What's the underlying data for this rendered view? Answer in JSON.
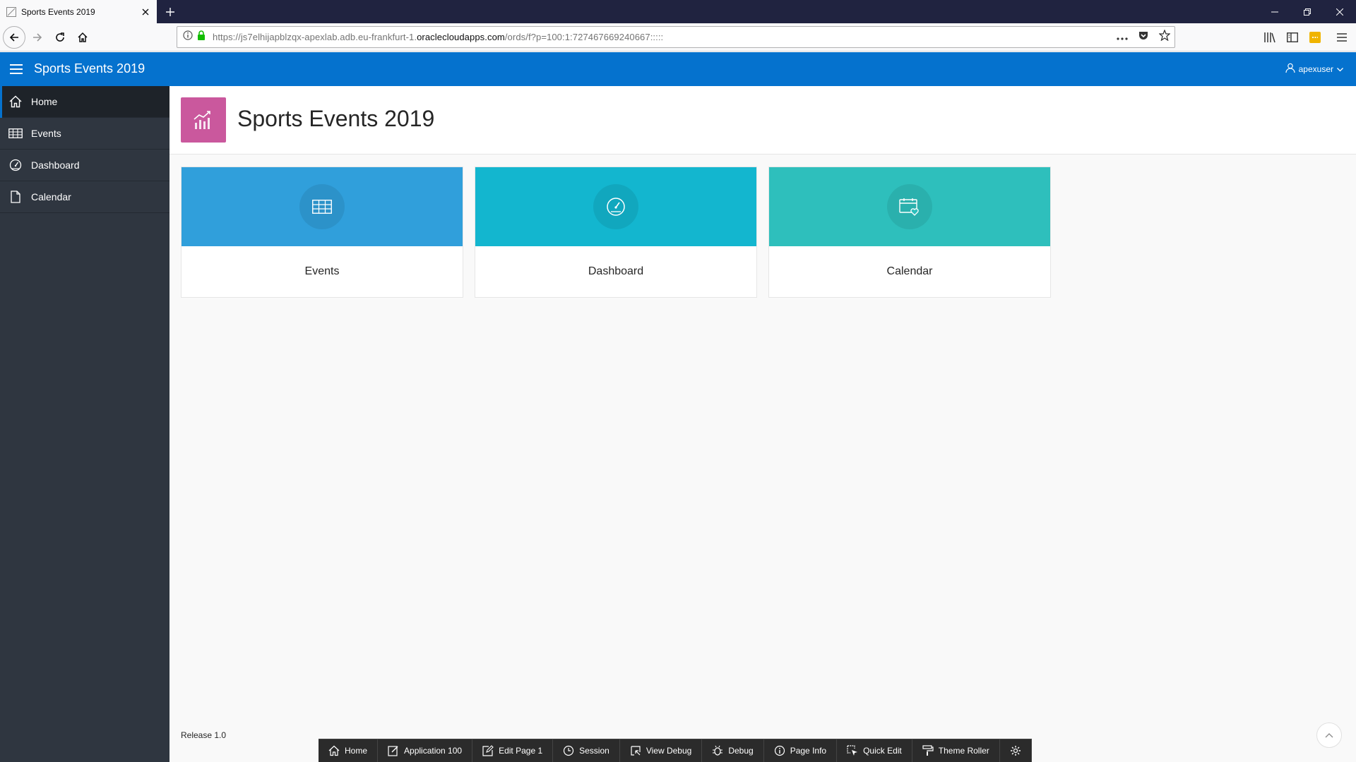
{
  "browser": {
    "tab_title": "Sports Events 2019",
    "url_prefix": "https://js7elhijapblzqx-apexlab.adb.eu-frankfurt-1.",
    "url_domain": "oraclecloudapps.com",
    "url_suffix": "/ords/f?p=100:1:727467669240667:::::",
    "url_actions": [
      "more-icon",
      "pocket-icon",
      "bookmark-star-icon"
    ],
    "toolbar_icons": [
      "library-icon",
      "sidebar-icon",
      "extension-icon",
      "menu-icon"
    ]
  },
  "header": {
    "app_title": "Sports Events 2019",
    "user": "apexuser",
    "color": "#0572ce"
  },
  "sidenav": {
    "items": [
      {
        "label": "Home",
        "icon": "home-icon",
        "active": true
      },
      {
        "label": "Events",
        "icon": "table-icon",
        "active": false
      },
      {
        "label": "Dashboard",
        "icon": "dashboard-icon",
        "active": false
      },
      {
        "label": "Calendar",
        "icon": "file-icon",
        "active": false
      }
    ]
  },
  "hero": {
    "title": "Sports Events 2019",
    "icon": "chart-line-icon",
    "icon_color": "#ca589d"
  },
  "cards": [
    {
      "label": "Events",
      "icon": "table-icon",
      "color": "#309fdb"
    },
    {
      "label": "Dashboard",
      "icon": "dashboard-icon",
      "color": "#13b6cf"
    },
    {
      "label": "Calendar",
      "icon": "calendar-heart-icon",
      "color": "#2ebfbc"
    }
  ],
  "footer": {
    "release": "Release 1.0"
  },
  "devbar": {
    "items": [
      {
        "label": "Home",
        "icon": "home-icon"
      },
      {
        "label": "Application 100",
        "icon": "edit-app-icon"
      },
      {
        "label": "Edit Page 1",
        "icon": "edit-page-icon"
      },
      {
        "label": "Session",
        "icon": "clock-icon"
      },
      {
        "label": "View Debug",
        "icon": "view-debug-icon"
      },
      {
        "label": "Debug",
        "icon": "bug-icon"
      },
      {
        "label": "Page Info",
        "icon": "info-icon"
      },
      {
        "label": "Quick Edit",
        "icon": "quick-edit-icon"
      },
      {
        "label": "Theme Roller",
        "icon": "paint-roller-icon"
      },
      {
        "label": "",
        "icon": "gear-icon"
      }
    ]
  }
}
